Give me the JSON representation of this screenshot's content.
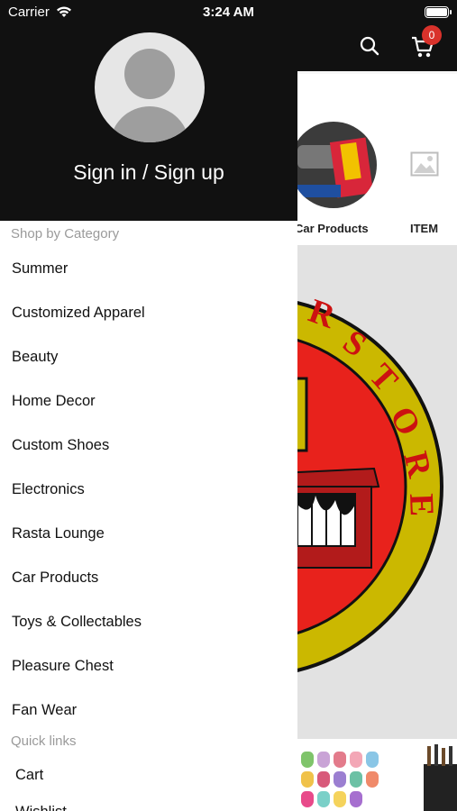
{
  "status_bar": {
    "carrier": "Carrier",
    "time": "3:24 AM"
  },
  "background": {
    "cart_count": "0",
    "categories": [
      {
        "label": "Car Products"
      },
      {
        "label": "ITEM"
      }
    ]
  },
  "drawer": {
    "sign_in_label": "Sign in / Sign up",
    "shop_by_category_title": "Shop by Category",
    "categories": [
      {
        "label": "Summer"
      },
      {
        "label": "Customized Apparel"
      },
      {
        "label": "Beauty"
      },
      {
        "label": "Home Decor"
      },
      {
        "label": "Custom Shoes"
      },
      {
        "label": "Electronics"
      },
      {
        "label": "Rasta Lounge"
      },
      {
        "label": "Car Products"
      },
      {
        "label": "Toys & Collectables"
      },
      {
        "label": "Pleasure Chest"
      },
      {
        "label": "Fan Wear"
      }
    ],
    "quick_links_title": "Quick links",
    "quick_links": [
      {
        "label": "Cart"
      },
      {
        "label": "Wishlist"
      }
    ]
  },
  "colors": {
    "header_bg": "#111111",
    "badge_red": "#d9322b",
    "logo_red": "#e8221c",
    "logo_yellow": "#c9b600"
  }
}
